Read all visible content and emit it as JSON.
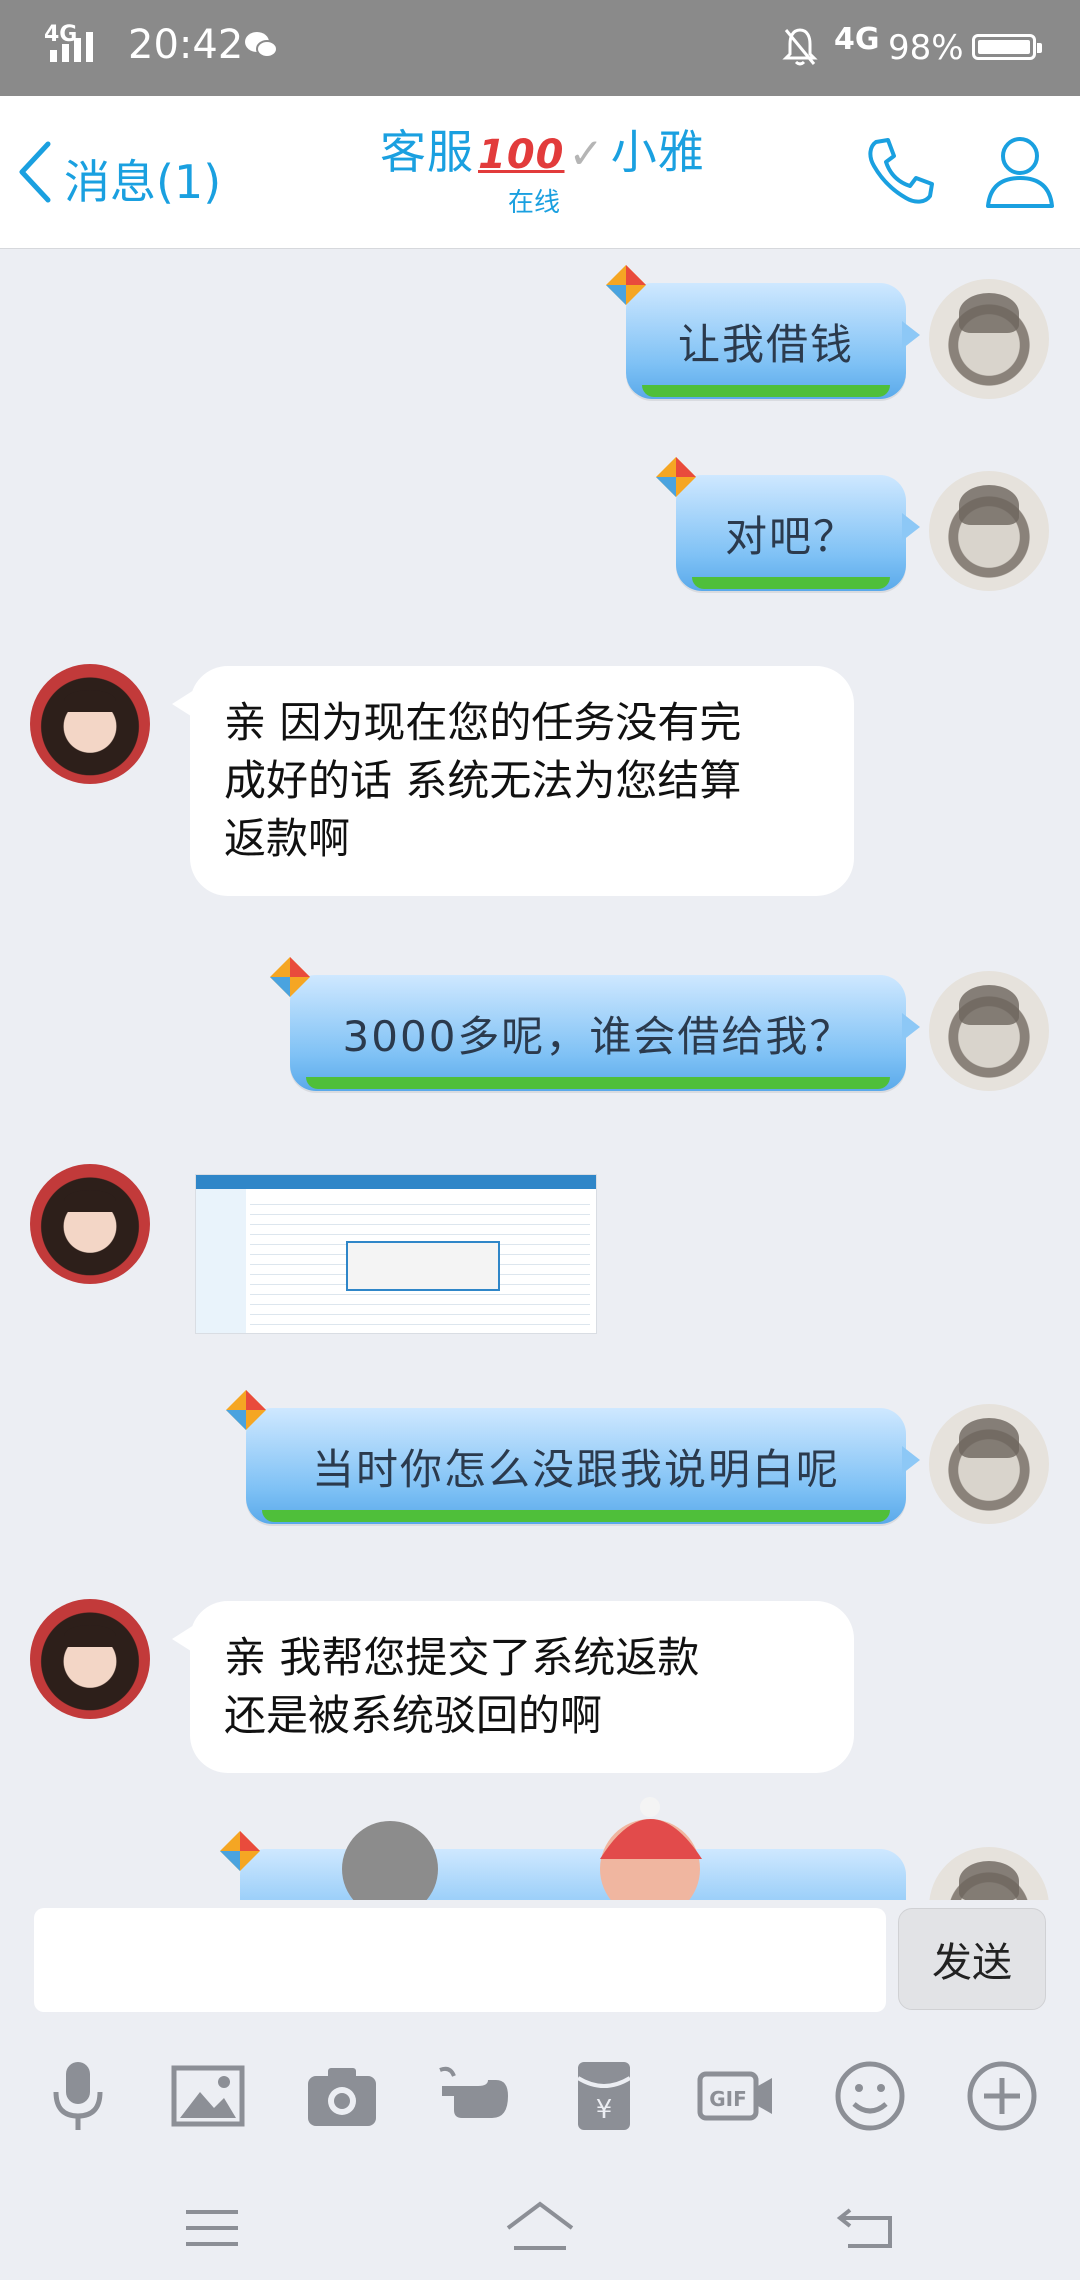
{
  "status_bar": {
    "signal_label": "4G",
    "time": "20:42",
    "network": "4G",
    "battery_percent": "98%",
    "icons": [
      "signal-icon",
      "wechat-icon",
      "mute-bell-icon",
      "battery-icon"
    ]
  },
  "nav": {
    "back_label": "消息(1)",
    "contact_prefix": "客服",
    "contact_badge": "100",
    "contact_suffix": "小雅",
    "status": "在线",
    "accent_color": "#1aa0e0"
  },
  "messages": [
    {
      "sender": "me",
      "text": "让我借钱"
    },
    {
      "sender": "me",
      "text": "对吧？"
    },
    {
      "sender": "cs",
      "lines": [
        "亲 因为现在您的任务没有完",
        "成好的话 系统无法为您结算",
        "返款啊"
      ]
    },
    {
      "sender": "me",
      "text": "3000多呢，谁会借给我？"
    },
    {
      "sender": "cs",
      "type": "image"
    },
    {
      "sender": "me",
      "text": "当时你怎么没跟我说明白呢"
    },
    {
      "sender": "cs",
      "lines": [
        "亲 我帮您提交了系统返款",
        "还是被系统驳回的啊"
      ]
    }
  ],
  "input": {
    "value": "",
    "send_label": "发送"
  },
  "toolbar": {
    "icons": [
      "microphone-icon",
      "image-icon",
      "camera-icon",
      "poke-hand-icon",
      "red-packet-icon",
      "gif-icon",
      "emoji-icon",
      "plus-icon"
    ]
  },
  "system_nav": {
    "icons": [
      "menu-icon",
      "home-icon",
      "back-icon"
    ]
  }
}
